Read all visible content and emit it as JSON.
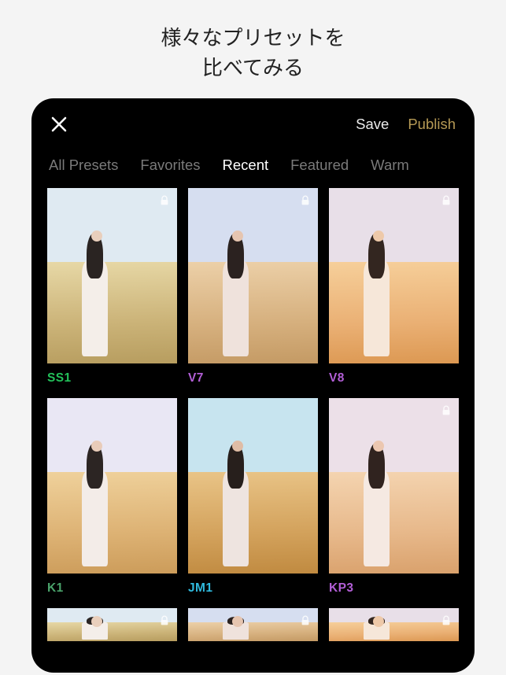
{
  "promo": {
    "line1": "様々なプリセットを",
    "line2": "比べてみる"
  },
  "topbar": {
    "save": "Save",
    "publish": "Publish"
  },
  "tabs": [
    {
      "label": "All Presets",
      "active": false
    },
    {
      "label": "Favorites",
      "active": false
    },
    {
      "label": "Recent",
      "active": true
    },
    {
      "label": "Featured",
      "active": false
    },
    {
      "label": "Warm",
      "active": false
    }
  ],
  "presets": [
    {
      "code": "SS1",
      "color": "#23c15a",
      "locked": true,
      "sky": "#dfeaf2",
      "grass": "linear-gradient(178deg,#e7d8a6,#cbb378 60%,#b79d5f)",
      "dress": "#f4eee9",
      "hair": "#2a2422",
      "skin": "#e9cfbc"
    },
    {
      "code": "V7",
      "color": "#b25ed6",
      "locked": true,
      "sky": "#d6def0",
      "grass": "linear-gradient(178deg,#ecd0a8,#d6b07e 60%,#c49a64)",
      "dress": "#efe2dc",
      "hair": "#2b2220",
      "skin": "#e6c5b0"
    },
    {
      "code": "V8",
      "color": "#b25ed6",
      "locked": true,
      "sky": "#e8dfe8",
      "grass": "linear-gradient(178deg,#f6cf9a,#eab074 60%,#dc9852)",
      "dress": "#f6e7d9",
      "hair": "#332620",
      "skin": "#eec9a9"
    },
    {
      "code": "K1",
      "color": "#4aa36b",
      "locked": false,
      "sky": "#e9e7f4",
      "grass": "linear-gradient(178deg,#efd19b,#ddb274 60%,#cc9c5a)",
      "dress": "#f3ece8",
      "hair": "#2c2523",
      "skin": "#e9ccb9"
    },
    {
      "code": "JM1",
      "color": "#2fb9dd",
      "locked": false,
      "sky": "#c7e4ef",
      "grass": "linear-gradient(178deg,#e9c487,#d3a25c 60%,#c08a40)",
      "dress": "#eee4e0",
      "hair": "#271f1c",
      "skin": "#dfbca5"
    },
    {
      "code": "KP3",
      "color": "#b25ed6",
      "locked": true,
      "sky": "#ece0e8",
      "grass": "linear-gradient(178deg,#f4d4b0,#e7b88a 60%,#d9a16c)",
      "dress": "#f5e9e2",
      "hair": "#30231f",
      "skin": "#ecc7b0"
    }
  ],
  "icons": {
    "close": "close-icon",
    "lock": "lock-icon"
  }
}
